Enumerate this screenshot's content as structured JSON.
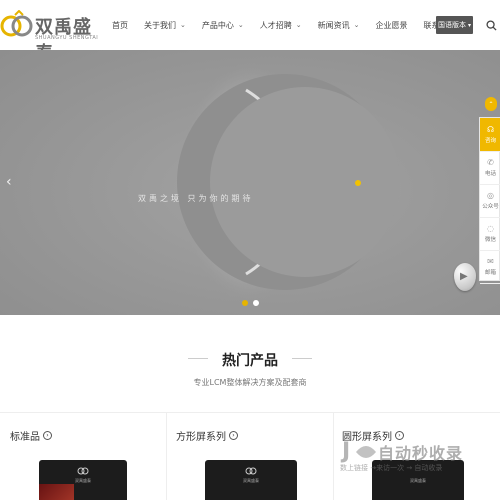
{
  "brand": {
    "name_cn": "双禹盛泰",
    "name_en": "SHUANGYU SHENGTAI"
  },
  "nav": {
    "items": [
      {
        "label": "首页",
        "has_dropdown": false
      },
      {
        "label": "关于我们",
        "has_dropdown": true
      },
      {
        "label": "产品中心",
        "has_dropdown": true
      },
      {
        "label": "人才招聘",
        "has_dropdown": true
      },
      {
        "label": "新闻资讯",
        "has_dropdown": true
      },
      {
        "label": "企业愿景",
        "has_dropdown": false
      },
      {
        "label": "联系我们",
        "has_dropdown": true
      }
    ],
    "lang_label": "国语版本",
    "search_icon": "search-icon"
  },
  "banner": {
    "slogan": "双禹之境 只为你的期待",
    "slide_count": 2,
    "active_slide": 1,
    "accent_color": "#e6b400"
  },
  "side_bar": {
    "top_badge": "⌃",
    "items": [
      {
        "label": "咨询",
        "icon": "headset-icon"
      },
      {
        "label": "电话",
        "icon": "phone-icon"
      },
      {
        "label": "公众号",
        "icon": "wechat-official-icon"
      },
      {
        "label": "微信",
        "icon": "wechat-icon"
      },
      {
        "label": "邮箱",
        "icon": "mail-icon"
      }
    ]
  },
  "section": {
    "title": "热门产品",
    "subtitle": "专业LCM整体解决方案及配套商"
  },
  "products": [
    {
      "title": "标准品",
      "img_caption": "双禹盛泰"
    },
    {
      "title": "方形屏系列",
      "img_caption": "双禹盛泰"
    },
    {
      "title": "圆形屏系列",
      "img_caption": "双禹盛泰"
    }
  ],
  "watermark": {
    "title": "自动秒收录",
    "subtitle": "数上链接 →来访一次 → 自动收录"
  }
}
